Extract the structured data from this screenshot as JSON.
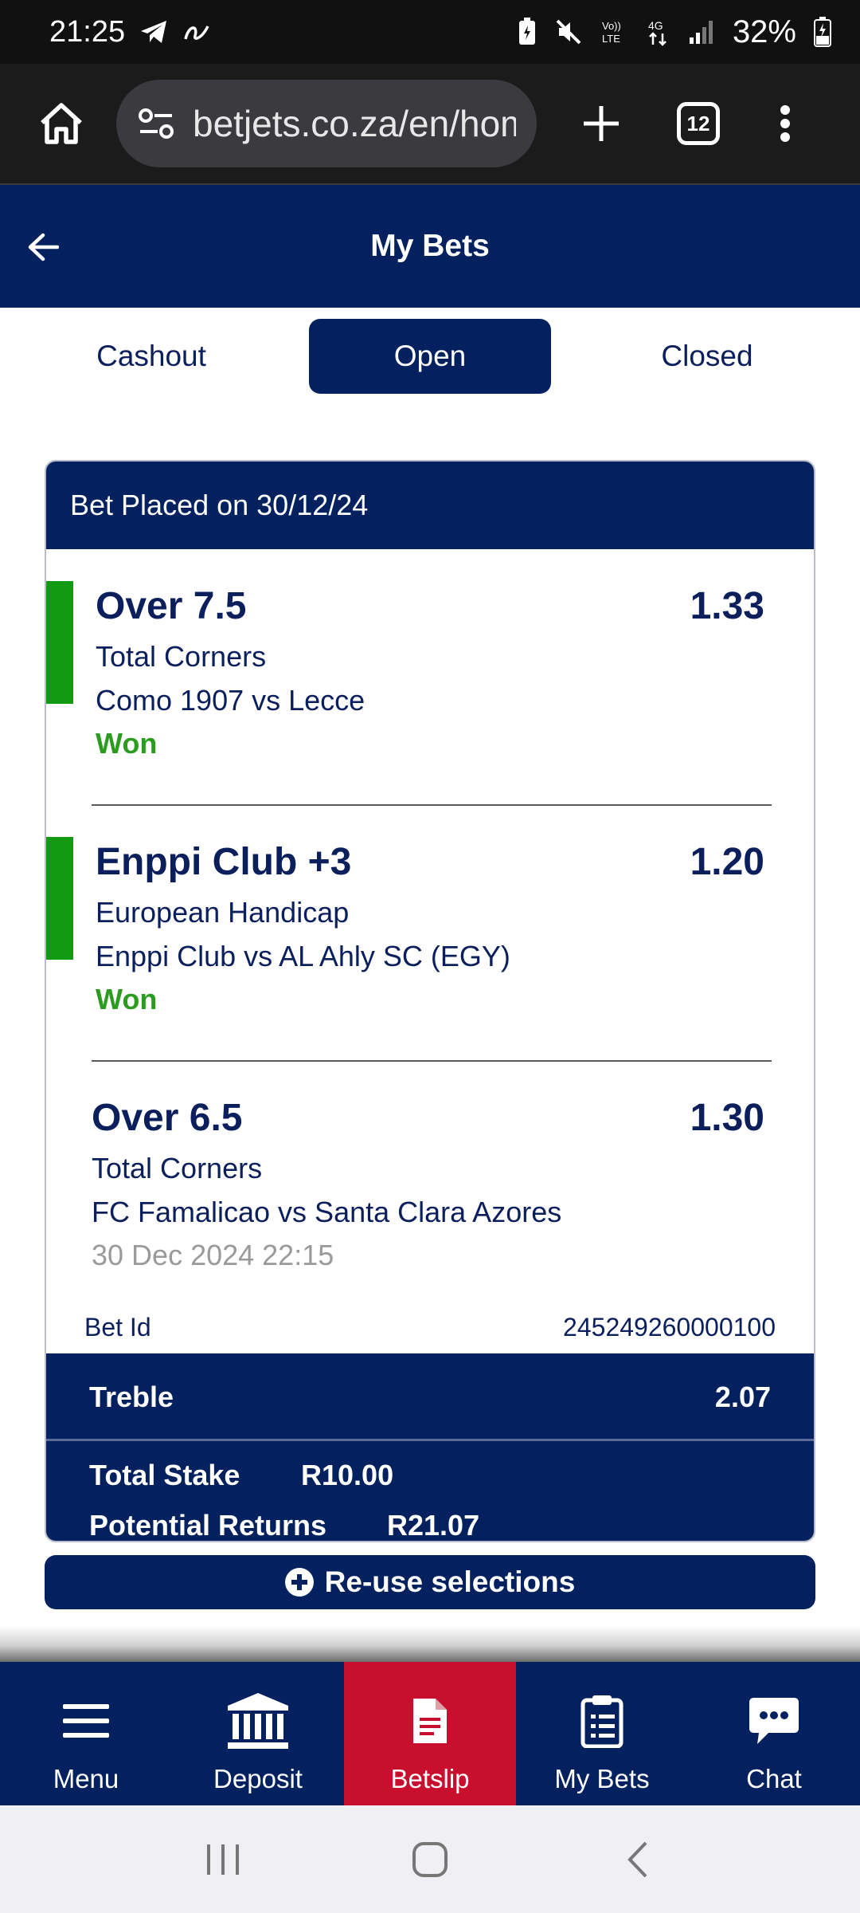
{
  "status_bar": {
    "time": "21:25",
    "battery": "32%"
  },
  "browser": {
    "url": "betjets.co.za/en/hom",
    "tab_count": "12"
  },
  "header": {
    "title": "My Bets"
  },
  "tabs": [
    {
      "label": "Cashout"
    },
    {
      "label": "Open"
    },
    {
      "label": "Closed"
    }
  ],
  "active_tab": "Open",
  "bet": {
    "placed_label": "Bet Placed on 30/12/24",
    "selections": [
      {
        "title": "Over 7.5",
        "odds": "1.33",
        "market": "Total Corners",
        "event": "Como 1907 vs Lecce",
        "status": "Won"
      },
      {
        "title": "Enppi Club +3",
        "odds": "1.20",
        "market": "European Handicap",
        "event": "Enppi Club vs AL Ahly SC (EGY)",
        "status": "Won"
      },
      {
        "title": "Over 6.5",
        "odds": "1.30",
        "market": "Total Corners",
        "event": "FC Famalicao vs Santa Clara Azores",
        "date": "30 Dec 2024 22:15"
      }
    ],
    "bet_id_label": "Bet Id",
    "bet_id": "245249260000100",
    "type_label": "Treble",
    "total_odds": "2.07",
    "stake_label": "Total Stake",
    "stake": "R10.00",
    "returns_label": "Potential Returns",
    "returns": "R21.07"
  },
  "reuse_label": "Re-use selections",
  "bottom_nav": [
    {
      "label": "Menu",
      "icon": "menu-icon"
    },
    {
      "label": "Deposit",
      "icon": "bank-icon"
    },
    {
      "label": "Betslip",
      "icon": "document-icon"
    },
    {
      "label": "My Bets",
      "icon": "clipboard-icon"
    },
    {
      "label": "Chat",
      "icon": "chat-icon"
    }
  ],
  "colors": {
    "primary": "#02215e",
    "accent_active": "#c8102e",
    "won": "#2a9c1e",
    "won_bar": "#129b12"
  }
}
